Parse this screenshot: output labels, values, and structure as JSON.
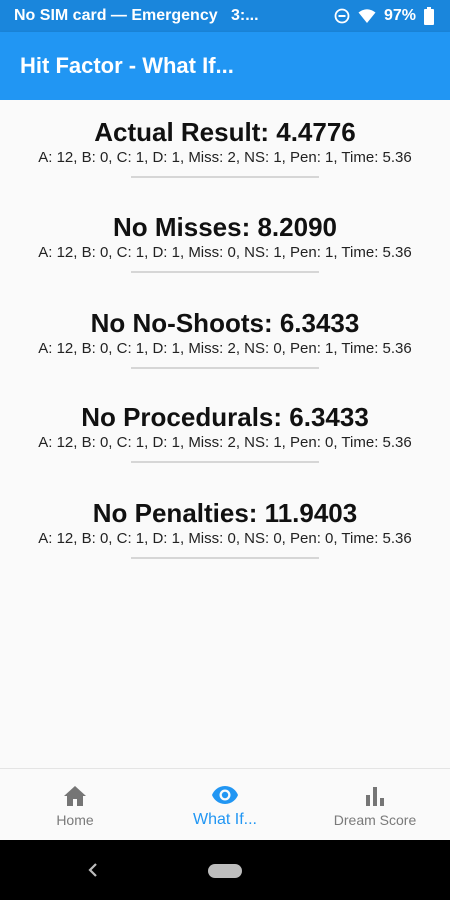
{
  "status_bar": {
    "carrier_text": "No SIM card — Emergency",
    "clock_text": "3:...",
    "battery_text": "97%",
    "icons": [
      "dnd-icon",
      "wifi-icon",
      "battery-icon"
    ]
  },
  "app_bar": {
    "title": "Hit Factor - What If..."
  },
  "results": [
    {
      "title": "Actual Result: 4.4776",
      "detail": "A: 12, B: 0, C: 1, D: 1, Miss: 2, NS: 1, Pen: 1, Time: 5.36"
    },
    {
      "title": "No Misses: 8.2090",
      "detail": "A: 12, B: 0, C: 1, D: 1, Miss: 0, NS: 1, Pen: 1, Time: 5.36"
    },
    {
      "title": "No No-Shoots: 6.3433",
      "detail": "A: 12, B: 0, C: 1, D: 1, Miss: 2, NS: 0, Pen: 1, Time: 5.36"
    },
    {
      "title": "No Procedurals: 6.3433",
      "detail": "A: 12, B: 0, C: 1, D: 1, Miss: 2, NS: 1, Pen: 0, Time: 5.36"
    },
    {
      "title": "No Penalties: 11.9403",
      "detail": "A: 12, B: 0, C: 1, D: 1, Miss: 0, NS: 0, Pen: 0, Time: 5.36"
    }
  ],
  "bottom_nav": {
    "items": [
      {
        "label": "Home",
        "icon": "home-icon",
        "active": false
      },
      {
        "label": "What If...",
        "icon": "eye-icon",
        "active": true
      },
      {
        "label": "Dream Score",
        "icon": "bar-chart-icon",
        "active": false
      }
    ]
  },
  "colors": {
    "primary": "#2196f3",
    "status_bar": "#1a86dc",
    "inactive_nav": "#7a7a7a"
  }
}
